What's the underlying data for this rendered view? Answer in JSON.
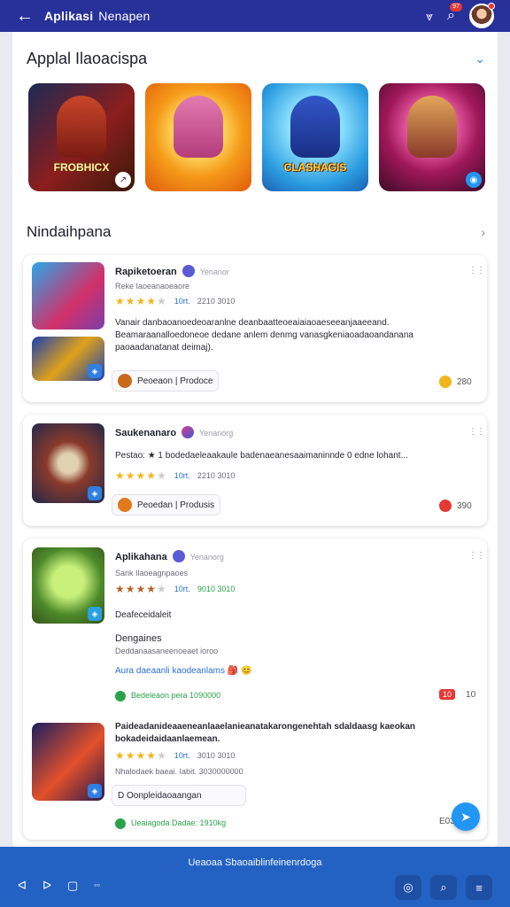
{
  "topbar": {
    "back_icon": "←",
    "title": "Aplikasi",
    "subtitle": "Nenapen",
    "filter_icon": "⩔",
    "search_icon": "⌕",
    "notification_count": "97"
  },
  "section1": {
    "title": "Applal Ilaoacispa",
    "chevron": "⌄"
  },
  "tiles": [
    {
      "label": "FROBHICX",
      "corner": "↗"
    },
    {
      "label": "",
      "corner": ""
    },
    {
      "label": "CLASHAGIS",
      "corner": ""
    },
    {
      "label": "",
      "corner": "◉"
    }
  ],
  "section2": {
    "title": "Nindaihpana",
    "chevron": "›"
  },
  "card1": {
    "title": "Rapiketoeran",
    "publisher": "Yenanor",
    "meta": "Reke Iaoeanaoeaore",
    "stars": "★★★★",
    "stars_off": "★",
    "rating_count": "10rt.",
    "rating_value": "2210 3010",
    "description": "Vanair danbaoanoedeoaranlne deanbaatteoeaiaiaoaeseeanjaaeeand. Beamaraanalloedoneoe dedane anlem denmg vanasgkeniaoadaoandanana paoaadanatanat deimaj).",
    "chip_text": "Peoeaon | Prodoce",
    "stat": "280"
  },
  "card2": {
    "title": "Saukenanaro",
    "publisher": "Yenanorg",
    "description": "Pestao: ★ 1 bodedaeleaakaule badenaeanesaaimaninnde 0 edne lohant...",
    "stars": "★★★★",
    "stars_off": "★",
    "rating_count": "10rt.",
    "rating_value": "2210 3010",
    "chip_text": "Peoedan | Produsis",
    "stat": "390"
  },
  "card3": {
    "title": "Aplikahana",
    "publisher": "Yenanorg",
    "meta": "Sank Ilaoeagnpaoes",
    "stars": "★★★★",
    "stars_off": "★",
    "rating_count": "10rt.",
    "rating_value": "9010 3010",
    "line1": "Deafeceidaleit",
    "line2": "Dengaines",
    "line3": "Deddanaasaneenoeaet ioroo",
    "link": "Aura daeaanli kaodeanlams 🎒 😊",
    "footer_text": "Bedeleaon pera 1090000",
    "badge": "10",
    "badge_count": "10"
  },
  "card3b": {
    "description": "Paideadanideaaeneanlaaelanieanatakarongenehtah sdaldaasg kaeokan bokadeidaidaanlaemean.",
    "stars": "★★★★",
    "stars_off": "★",
    "rating_count": "10rt.",
    "rating_value": "3010 3010",
    "meta": "Nhalodaek baeai. Iabit. 3030000000",
    "chip_text": "D  Oonpleidaoaangan",
    "footer_text": "Ueaiagoda Dadae: 1910kg",
    "stat": "E03"
  },
  "fab_icon": "➤",
  "bottombar": {
    "banner": "Ueaoaa Sbaoaiblinfeinenrdoga",
    "nav_back": "ᐊ",
    "nav_share": "ᐅ",
    "nav_note": "▢",
    "nav_more": "▫▫",
    "btn_shield": "◎",
    "btn_search": "⌕",
    "btn_menu": "≡"
  }
}
